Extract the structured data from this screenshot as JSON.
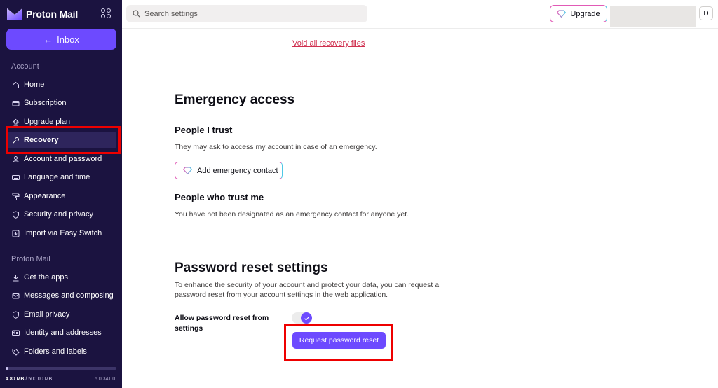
{
  "brand": {
    "name": "Proton Mail"
  },
  "sidebar": {
    "back_button": "Inbox",
    "sections": [
      {
        "title": "Account",
        "items": [
          {
            "label": "Home",
            "icon": "home-icon"
          },
          {
            "label": "Subscription",
            "icon": "credit-card-icon"
          },
          {
            "label": "Upgrade plan",
            "icon": "upgrade-arrow-icon"
          },
          {
            "label": "Recovery",
            "icon": "key-icon",
            "active": true
          },
          {
            "label": "Account and password",
            "icon": "user-icon"
          },
          {
            "label": "Language and time",
            "icon": "keyboard-icon"
          },
          {
            "label": "Appearance",
            "icon": "paint-roller-icon"
          },
          {
            "label": "Security and privacy",
            "icon": "shield-icon"
          },
          {
            "label": "Import via Easy Switch",
            "icon": "import-icon"
          }
        ]
      },
      {
        "title": "Proton Mail",
        "items": [
          {
            "label": "Get the apps",
            "icon": "download-icon"
          },
          {
            "label": "Messages and composing",
            "icon": "envelope-icon"
          },
          {
            "label": "Email privacy",
            "icon": "shield-icon"
          },
          {
            "label": "Identity and addresses",
            "icon": "id-card-icon"
          },
          {
            "label": "Folders and labels",
            "icon": "tag-icon"
          }
        ]
      }
    ],
    "storage": {
      "used": "4.80 MB",
      "separator": " / ",
      "total": "500.00 MB",
      "fraction": 0.0096
    },
    "version": "5.0.341.0"
  },
  "header": {
    "search_placeholder": "Search settings",
    "upgrade_label": "Upgrade",
    "avatar_initial": "D"
  },
  "main": {
    "void_link": "Void all recovery files",
    "emergency": {
      "title": "Emergency access",
      "people_i_trust_title": "People I trust",
      "people_i_trust_desc": "They may ask to access my account in case of an emergency.",
      "add_contact_button": "Add emergency contact",
      "people_trust_me_title": "People who trust me",
      "people_trust_me_desc": "You have not been designated as an emergency contact for anyone yet."
    },
    "password_reset": {
      "title": "Password reset settings",
      "desc_line1": "To enhance the security of your account and protect your data, you can request a",
      "desc_line2": "password reset from your account settings in the web application.",
      "allow_label_line1": "Allow password reset from",
      "allow_label_line2": "settings",
      "toggle_on": true,
      "request_button": "Request password reset"
    }
  },
  "colors": {
    "sidebar_bg": "#1b1340",
    "accent": "#6d4aff",
    "highlight": "#ee0000",
    "link": "#d0304f"
  }
}
